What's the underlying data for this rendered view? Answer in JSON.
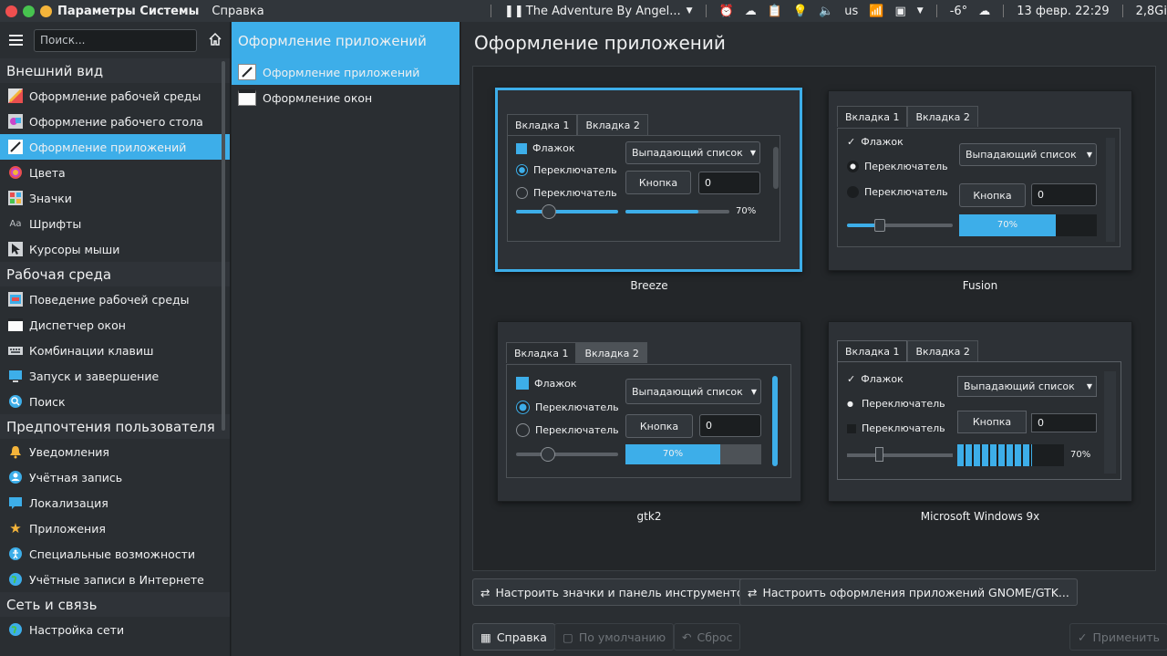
{
  "topbar": {
    "app_title": "Параметры Системы",
    "menu_help": "Справка",
    "media": "The Adventure By Angel...",
    "lang": "us",
    "temp": "-6°",
    "datetime": "13 февр. 22:29",
    "mem": "2,8Gi"
  },
  "sidebar": {
    "search_placeholder": "Поиск...",
    "groups": [
      {
        "title": "Внешний вид",
        "items": [
          "Оформление рабочей среды",
          "Оформление рабочего стола",
          "Оформление приложений",
          "Цвета",
          "Значки",
          "Шрифты",
          "Курсоры мыши"
        ]
      },
      {
        "title": "Рабочая среда",
        "items": [
          "Поведение рабочей среды",
          "Диспетчер окон",
          "Комбинации клавиш",
          "Запуск и завершение",
          "Поиск"
        ]
      },
      {
        "title": "Предпочтения пользователя",
        "items": [
          "Уведомления",
          "Учётная запись",
          "Локализация",
          "Приложения",
          "Специальные возможности",
          "Учётные записи в Интернете"
        ]
      },
      {
        "title": "Сеть и связь",
        "items": [
          "Настройка сети"
        ]
      }
    ],
    "selected": "Оформление приложений"
  },
  "middle": {
    "header": "Оформление приложений",
    "items": [
      "Оформление приложений",
      "Оформление окон"
    ]
  },
  "main": {
    "title": "Оформление приложений",
    "styles": [
      {
        "name": "Breeze",
        "tab1": "Вкладка 1",
        "tab2": "Вкладка 2",
        "checkbox": "Флажок",
        "radio1": "Переключатель",
        "radio2": "Переключатель",
        "combo": "Выпадающий список",
        "button": "Кнопка",
        "spin": "0",
        "progress": "70%",
        "progress_value": 70
      },
      {
        "name": "Fusion",
        "tab1": "Вкладка 1",
        "tab2": "Вкладка 2",
        "checkbox": "Флажок",
        "radio1": "Переключатель",
        "radio2": "Переключатель",
        "combo": "Выпадающий список",
        "button": "Кнопка",
        "spin": "0",
        "progress": "70%",
        "progress_value": 70
      },
      {
        "name": "gtk2",
        "tab1": "Вкладка 1",
        "tab2": "Вкладка 2",
        "checkbox": "Флажок",
        "radio1": "Переключатель",
        "radio2": "Переключатель",
        "combo": "Выпадающий список",
        "button": "Кнопка",
        "spin": "0",
        "progress": "70%",
        "progress_value": 70
      },
      {
        "name": "Microsoft Windows 9x",
        "tab1": "Вкладка 1",
        "tab2": "Вкладка 2",
        "checkbox": "Флажок",
        "radio1": "Переключатель",
        "radio2": "Переключатель",
        "combo": "Выпадающий список",
        "button": "Кнопка",
        "spin": "0",
        "progress": "70%",
        "progress_value": 70
      }
    ],
    "configure_icons": "Настроить значки и панель инструментов",
    "configure_gtk": "Настроить оформления приложений GNOME/GTK...",
    "help": "Справка",
    "defaults": "По умолчанию",
    "reset": "Сброс",
    "apply": "Применить"
  },
  "colors": {
    "accent": "#3daee9",
    "bg": "#2a2e32",
    "close": "#ef4f4f",
    "max": "#47c34f",
    "min": "#f4b43a"
  }
}
